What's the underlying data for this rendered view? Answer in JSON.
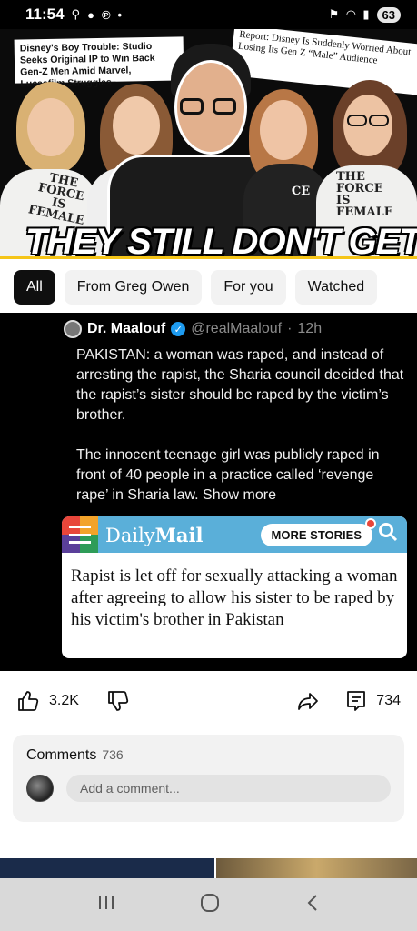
{
  "status_bar": {
    "time": "11:54",
    "battery": "63"
  },
  "video": {
    "headline_left": "Disney's Boy Trouble: Studio Seeks Original IP to Win Back Gen-Z Men Amid Marvel, Lucasfilm Struggles",
    "headline_right": "Report: Disney Is Suddenly Worried About Losing Its Gen Z “Male” Audience",
    "shirt_text_left": "THE\nFORCE\nIS\nFEMALE",
    "shirt_text_right": "THE\nFORCE\nIS\nFEMALE",
    "shirt_text_mid": "CE",
    "overlay_title": "THEY STILL DON'T GET IT",
    "progress_color": "#f5c518"
  },
  "chips": [
    {
      "label": "All",
      "active": true
    },
    {
      "label": "From Greg Owen",
      "active": false
    },
    {
      "label": "For you",
      "active": false
    },
    {
      "label": "Watched",
      "active": false
    }
  ],
  "post": {
    "author_name": "Dr. Maalouf",
    "handle": "@realMaalouf",
    "time": "12h",
    "body": "PAKISTAN: a woman was raped, and instead of arresting the rapist, the Sharia council decided that the rapist’s sister should be raped by the victim’s brother.\n\nThe innocent teenage girl was publicly raped in front of 40 people in a practice called ‘revenge rape’ in Sharia law. Show more",
    "card": {
      "brand_light": "Daily",
      "brand_bold": "Mail",
      "more_button": "MORE STORIES",
      "headline": "Rapist is let off for sexually attacking a woman after agreeing to allow his sister to be raped by his victim's brother in Pakistan",
      "bar_color": "#5aafd9"
    }
  },
  "actions": {
    "like_count": "3.2K",
    "comment_count": "734"
  },
  "comments": {
    "title": "Comments",
    "count": "736",
    "placeholder": "Add a comment..."
  }
}
